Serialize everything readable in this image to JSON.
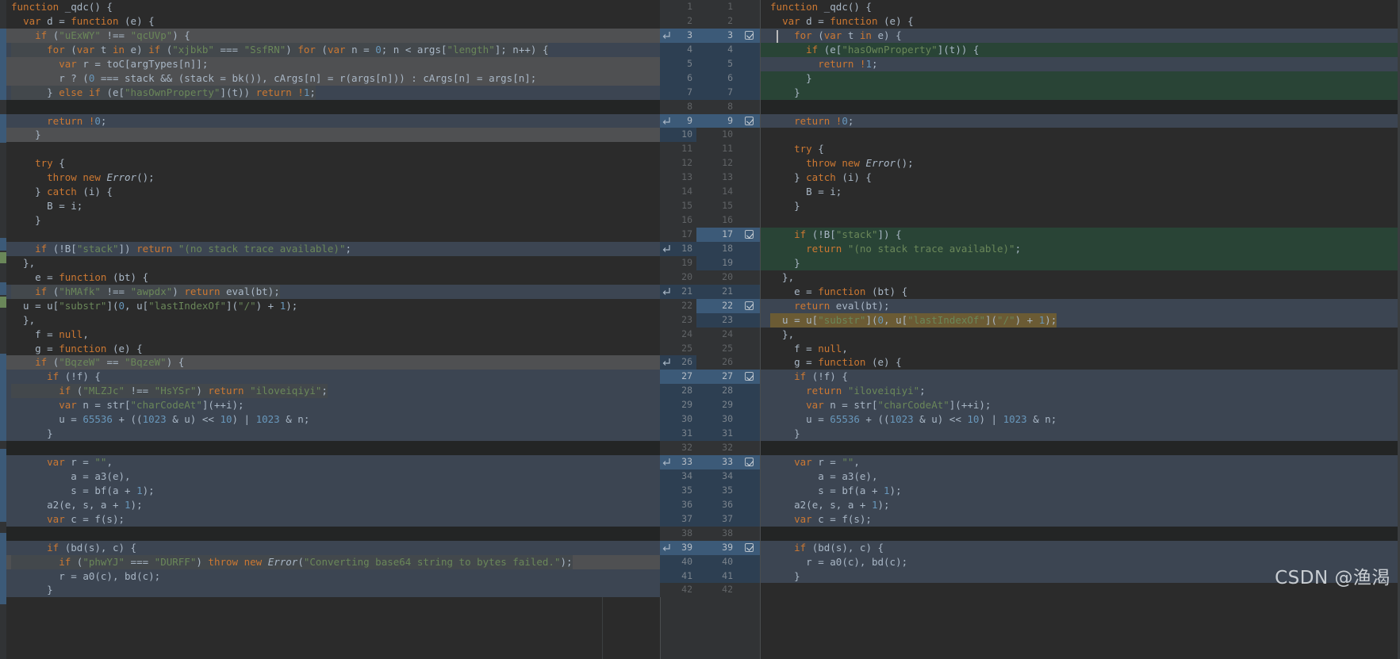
{
  "app": {
    "kind": "diff-viewer",
    "title": "JavaScript file diff",
    "watermark": "CSDN @渔渴",
    "theme": {
      "editor_bg": "#2b2b2b",
      "gutter_bg": "#313335",
      "changed_row": "#3c4552",
      "inserted_row": "#294436",
      "gray_row": "#4f5052",
      "gap_row": "#232525",
      "gutter_highlight": "#3c5a78",
      "text": "#a9b7c6",
      "keyword": "#cc7832",
      "string": "#6a8759",
      "number": "#6897bb",
      "function": "#ffc66d",
      "inline_word_highlight": "#6b5b34"
    }
  },
  "gutter": {
    "left_numbers": [
      "1",
      "2",
      "3",
      "4",
      "5",
      "6",
      "7",
      "8",
      "9",
      "10",
      "11",
      "12",
      "13",
      "14",
      "15",
      "16",
      "17",
      "18",
      "19",
      "20",
      "21",
      "22",
      "23",
      "24",
      "25",
      "26",
      "27",
      "28",
      "29",
      "30",
      "31",
      "32",
      "33",
      "34",
      "35",
      "36",
      "37",
      "38",
      "39",
      "40",
      "41",
      "42"
    ],
    "right_numbers": [
      "1",
      "2",
      "3",
      "4",
      "5",
      "6",
      "7",
      "8",
      "9",
      "10",
      "11",
      "12",
      "13",
      "14",
      "15",
      "16",
      "17",
      "18",
      "19",
      "20",
      "21",
      "22",
      "23",
      "24",
      "25",
      "26",
      "27",
      "28",
      "29",
      "30",
      "31",
      "32",
      "33",
      "34",
      "35",
      "36",
      "37",
      "38",
      "39",
      "40",
      "41",
      "42"
    ],
    "accept_checkbox_rows": [
      3,
      9,
      17,
      22,
      27,
      33,
      39
    ],
    "apply_arrow_rows": [
      3,
      9,
      18,
      21,
      26,
      33,
      39
    ],
    "checkbox_icon": "accept-change-checkbox-icon",
    "arrow_icon": "apply-change-arrow-icon"
  },
  "left_pane": {
    "name": "original-code-pane",
    "lines": [
      {
        "t": "function _qdc() {",
        "bg": "none"
      },
      {
        "t": "  var d = function (e) {",
        "bg": "none"
      },
      {
        "t": "    if (\"uExWY\" !== \"qcUVp\") {",
        "bg": "gray"
      },
      {
        "t": "      for (var t in e) if (\"xjbkb\" === \"SsfRN\") for (var n = 0; n < args[\"length\"]; n++) {",
        "bg": "changed"
      },
      {
        "t": "        var r = toC[argTypes[n]];",
        "bg": "gray"
      },
      {
        "t": "        r ? (0 === stack && (stack = bk()), cArgs[n] = r(args[n])) : cArgs[n] = args[n];",
        "bg": "gray"
      },
      {
        "t": "      } else if (e[\"hasOwnProperty\"](t)) return !1;",
        "bg": "changed"
      },
      {
        "t": "",
        "bg": "empty"
      },
      {
        "t": "      return !0;",
        "bg": "changed"
      },
      {
        "t": "    }",
        "bg": "gray"
      },
      {
        "t": "",
        "bg": "none"
      },
      {
        "t": "    try {",
        "bg": "none"
      },
      {
        "t": "      throw new Error();",
        "bg": "none"
      },
      {
        "t": "    } catch (i) {",
        "bg": "none"
      },
      {
        "t": "      B = i;",
        "bg": "none"
      },
      {
        "t": "    }",
        "bg": "none"
      },
      {
        "t": "",
        "bg": "none"
      },
      {
        "t": "    if (!B[\"stack\"]) return \"(no stack trace available)\";",
        "bg": "changed"
      },
      {
        "t": "  },",
        "bg": "none"
      },
      {
        "t": "    e = function (bt) {",
        "bg": "none"
      },
      {
        "t": "    if (\"hMAfk\" !== \"awpdx\") return eval(bt);",
        "bg": "changed"
      },
      {
        "t": "  u = u[\"substr\"](0, u[\"lastIndexOf\"](\"/\") + 1);",
        "bg": "none"
      },
      {
        "t": "  },",
        "bg": "none"
      },
      {
        "t": "    f = null,",
        "bg": "none"
      },
      {
        "t": "    g = function (e) {",
        "bg": "none"
      },
      {
        "t": "    if (\"BqzeW\" == \"BqzeW\") {",
        "bg": "gray"
      },
      {
        "t": "      if (!f) {",
        "bg": "changed"
      },
      {
        "t": "        if (\"MLZJc\" !== \"HsYSr\") return \"iloveiqiyi\";",
        "bg": "changed"
      },
      {
        "t": "        var n = str[\"charCodeAt\"](++i);",
        "bg": "changed"
      },
      {
        "t": "        u = 65536 + ((1023 & u) << 10) | 1023 & n;",
        "bg": "changed"
      },
      {
        "t": "      }",
        "bg": "changed"
      },
      {
        "t": "",
        "bg": "empty"
      },
      {
        "t": "      var r = \"\",",
        "bg": "changed"
      },
      {
        "t": "          a = a3(e),",
        "bg": "changed"
      },
      {
        "t": "          s = bf(a + 1);",
        "bg": "changed"
      },
      {
        "t": "      a2(e, s, a + 1);",
        "bg": "changed"
      },
      {
        "t": "      var c = f(s);",
        "bg": "changed"
      },
      {
        "t": "",
        "bg": "empty"
      },
      {
        "t": "      if (bd(s), c) {",
        "bg": "changed"
      },
      {
        "t": "        if (\"phwYJ\" === \"DURFF\") throw new Error(\"Converting base64 string to bytes failed.\");",
        "bg": "gray"
      },
      {
        "t": "        r = a0(c), bd(c);",
        "bg": "changed"
      },
      {
        "t": "      }",
        "bg": "changed"
      }
    ]
  },
  "right_pane": {
    "name": "modified-code-pane",
    "lines": [
      {
        "t": "function _qdc() {",
        "bg": "none"
      },
      {
        "t": "  var d = function (e) {",
        "bg": "none"
      },
      {
        "t": "    for (var t in e) {",
        "bg": "changed"
      },
      {
        "t": "      if (e[\"hasOwnProperty\"](t)) {",
        "bg": "insert"
      },
      {
        "t": "        return !1;",
        "bg": "changed"
      },
      {
        "t": "      }",
        "bg": "insert"
      },
      {
        "t": "    }",
        "bg": "insert"
      },
      {
        "t": "",
        "bg": "empty"
      },
      {
        "t": "    return !0;",
        "bg": "changed"
      },
      {
        "t": "",
        "bg": "none"
      },
      {
        "t": "    try {",
        "bg": "none"
      },
      {
        "t": "      throw new Error();",
        "bg": "none"
      },
      {
        "t": "    } catch (i) {",
        "bg": "none"
      },
      {
        "t": "      B = i;",
        "bg": "none"
      },
      {
        "t": "    }",
        "bg": "none"
      },
      {
        "t": "",
        "bg": "none"
      },
      {
        "t": "    if (!B[\"stack\"]) {",
        "bg": "insert"
      },
      {
        "t": "      return \"(no stack trace available)\";",
        "bg": "insert"
      },
      {
        "t": "    }",
        "bg": "insert"
      },
      {
        "t": "  },",
        "bg": "none"
      },
      {
        "t": "    e = function (bt) {",
        "bg": "none"
      },
      {
        "t": "    return eval(bt);",
        "bg": "changed"
      },
      {
        "t": "  u = u[\"substr\"](0, u[\"lastIndexOf\"](\"/\") + 1);",
        "bg": "changed"
      },
      {
        "t": "  },",
        "bg": "none"
      },
      {
        "t": "    f = null,",
        "bg": "none"
      },
      {
        "t": "    g = function (e) {",
        "bg": "none"
      },
      {
        "t": "    if (!f) {",
        "bg": "changed"
      },
      {
        "t": "      return \"iloveiqiyi\";",
        "bg": "changed"
      },
      {
        "t": "      var n = str[\"charCodeAt\"](++i);",
        "bg": "changed"
      },
      {
        "t": "      u = 65536 + ((1023 & u) << 10) | 1023 & n;",
        "bg": "changed"
      },
      {
        "t": "    }",
        "bg": "changed"
      },
      {
        "t": "",
        "bg": "empty"
      },
      {
        "t": "    var r = \"\",",
        "bg": "changed"
      },
      {
        "t": "        a = a3(e),",
        "bg": "changed"
      },
      {
        "t": "        s = bf(a + 1);",
        "bg": "changed"
      },
      {
        "t": "    a2(e, s, a + 1);",
        "bg": "changed"
      },
      {
        "t": "    var c = f(s);",
        "bg": "changed"
      },
      {
        "t": "",
        "bg": "empty"
      },
      {
        "t": "    if (bd(s), c) {",
        "bg": "changed"
      },
      {
        "t": "      r = a0(c), bd(c);",
        "bg": "changed"
      },
      {
        "t": "    }",
        "bg": "changed"
      }
    ]
  },
  "notable_strings": {
    "obfuscated_guards": [
      "uExWY",
      "qcUVp",
      "xjbkb",
      "SsfRN",
      "hMAfk",
      "awpdx",
      "BqzeW",
      "MLZJc",
      "HsYSr",
      "phwYJ",
      "DURFF"
    ],
    "messages": [
      "(no stack trace available)",
      "iloveiqiyi",
      "Converting base64 string to bytes failed."
    ],
    "property_keys": [
      "hasOwnProperty",
      "length",
      "stack",
      "substr",
      "lastIndexOf",
      "charCodeAt"
    ],
    "numbers": [
      "0",
      "1",
      "65536",
      "1023",
      "10"
    ]
  }
}
